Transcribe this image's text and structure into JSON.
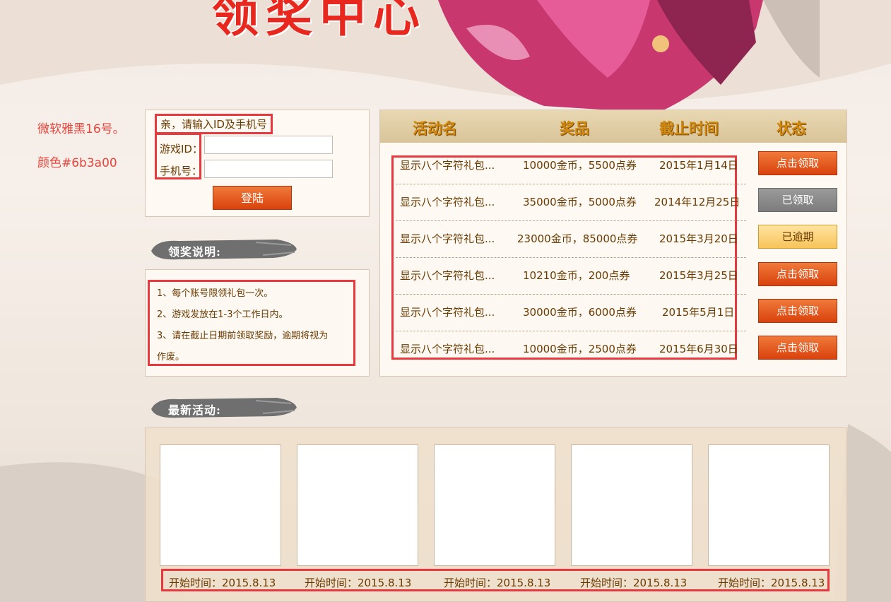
{
  "header": {
    "title": "领奖中心"
  },
  "notes": {
    "font_note": "微软雅黑16号。",
    "color_note": "颜色#6b3a00"
  },
  "colors": {
    "text": "#6b3a00",
    "accent_red": "#e8281f",
    "button_orange": "#d9420c",
    "button_gray": "#7c7c7c",
    "button_yellow": "#f7c45a"
  },
  "login": {
    "hint": "亲，请输入ID及手机号",
    "game_id_label": "游戏ID：",
    "phone_label": "手机号：",
    "game_id_value": "",
    "phone_value": "",
    "submit_label": "登陆"
  },
  "rules": {
    "heading": "领奖说明:",
    "items": [
      "1、每个账号限领礼包一次。",
      "2、游戏发放在1-3个工作日内。",
      "3、请在截止日期前领取奖励，逾期将视为",
      "作废。"
    ]
  },
  "rewards": {
    "headers": {
      "name": "活动名",
      "prize": "奖品",
      "deadline": "截止时间",
      "status": "状态"
    },
    "rows": [
      {
        "name": "显示八个字符礼包...",
        "prize": "10000金币，5500点券",
        "deadline": "2015年1月14日",
        "status": "点击领取",
        "state": "claim"
      },
      {
        "name": "显示八个字符礼包...",
        "prize": "35000金币，5000点券",
        "deadline": "2014年12月25日",
        "status": "已领取",
        "state": "done"
      },
      {
        "name": "显示八个字符礼包...",
        "prize": "23000金币，85000点券",
        "deadline": "2015年3月20日",
        "status": "已逾期",
        "state": "expired"
      },
      {
        "name": "显示八个字符礼包...",
        "prize": "10210金币，200点券",
        "deadline": "2015年3月25日",
        "status": "点击领取",
        "state": "claim"
      },
      {
        "name": "显示八个字符礼包...",
        "prize": "30000金币，6000点券",
        "deadline": "2015年5月1日",
        "status": "点击领取",
        "state": "claim"
      },
      {
        "name": "显示八个字符礼包...",
        "prize": "10000金币，2500点券",
        "deadline": "2015年6月30日",
        "status": "点击领取",
        "state": "claim"
      }
    ]
  },
  "activities": {
    "heading": "最新活动:",
    "items": [
      {
        "start": "开始时间：2015.8.13"
      },
      {
        "start": "开始时间：2015.8.13"
      },
      {
        "start": "开始时间：2015.8.13"
      },
      {
        "start": "开始时间：2015.8.13"
      },
      {
        "start": "开始时间：2015.8.13"
      }
    ]
  }
}
